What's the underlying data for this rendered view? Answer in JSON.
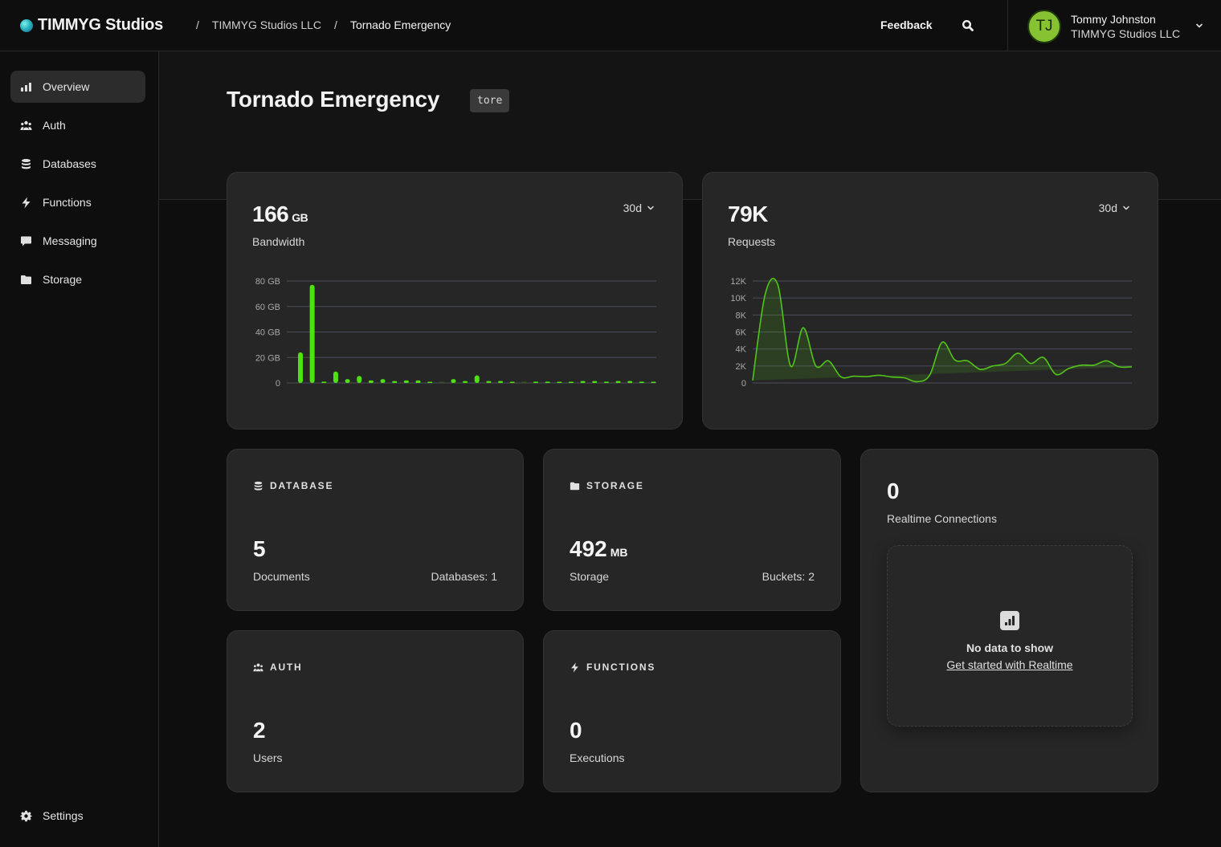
{
  "app": {
    "brand": "TIMMYG Studios",
    "breadcrumb": [
      "TIMMYG Studios LLC",
      "Tornado Emergency"
    ],
    "breadcrumb_separator": "/",
    "feedback_label": "Feedback",
    "search_icon": "search-icon",
    "user": {
      "initials": "TJ",
      "name": "Tommy Johnston",
      "org": "TIMMYG Studios LLC",
      "avatar_color": "#86c232"
    }
  },
  "sidebar": {
    "items": [
      {
        "label": "Overview",
        "icon": "bar-chart-icon",
        "active": true
      },
      {
        "label": "Auth",
        "icon": "users-icon",
        "active": false
      },
      {
        "label": "Databases",
        "icon": "database-icon",
        "active": false
      },
      {
        "label": "Functions",
        "icon": "lightning-icon",
        "active": false
      },
      {
        "label": "Messaging",
        "icon": "chat-icon",
        "active": false
      },
      {
        "label": "Storage",
        "icon": "folder-icon",
        "active": false
      }
    ],
    "settings_label": "Settings"
  },
  "page": {
    "title": "Tornado Emergency",
    "project_tag": "tore"
  },
  "bandwidth": {
    "value": "166",
    "unit": "GB",
    "label": "Bandwidth",
    "range": "30d"
  },
  "requests": {
    "value": "79K",
    "label": "Requests",
    "range": "30d"
  },
  "database": {
    "heading": "DATABASE",
    "value": "5",
    "label": "Documents",
    "secondary": "Databases: 1"
  },
  "storage": {
    "heading": "STORAGE",
    "value": "492",
    "unit": "MB",
    "label": "Storage",
    "secondary": "Buckets: 2"
  },
  "auth": {
    "heading": "AUTH",
    "value": "2",
    "label": "Users"
  },
  "functions": {
    "heading": "FUNCTIONS",
    "value": "0",
    "label": "Executions"
  },
  "realtime": {
    "value": "0",
    "label": "Realtime Connections",
    "empty_title": "No data to show",
    "empty_link": "Get started with Realtime"
  },
  "chart_data": [
    {
      "type": "bar",
      "title": "Bandwidth",
      "ylabel": "",
      "xlabel": "",
      "yticks": [
        "0",
        "20 GB",
        "40 GB",
        "60 GB",
        "80 GB"
      ],
      "ylim": [
        0,
        80
      ],
      "grid": true,
      "color": "#4ee10f",
      "values": [
        24,
        77,
        1,
        9,
        3,
        5.5,
        2,
        3,
        1.5,
        2,
        2,
        0.6,
        0.2,
        3,
        1.5,
        6,
        1.5,
        1.5,
        0.5,
        0.2,
        1,
        1,
        0.5,
        0.5,
        1.5,
        1.5,
        1,
        1.5,
        1.5,
        1,
        0.4
      ]
    },
    {
      "type": "area",
      "title": "Requests",
      "ylabel": "",
      "xlabel": "",
      "yticks": [
        "0",
        "2K",
        "4K",
        "6K",
        "8K",
        "10K",
        "12K"
      ],
      "ylim": [
        0,
        12000
      ],
      "grid": true,
      "color": "#52c41a",
      "values": [
        300,
        10500,
        11500,
        2000,
        6500,
        2000,
        2600,
        700,
        800,
        750,
        900,
        700,
        600,
        150,
        900,
        4800,
        2700,
        2600,
        1600,
        2000,
        2300,
        3500,
        2300,
        3000,
        1000,
        1700,
        2100,
        2100,
        2600,
        1900,
        1900
      ]
    }
  ]
}
